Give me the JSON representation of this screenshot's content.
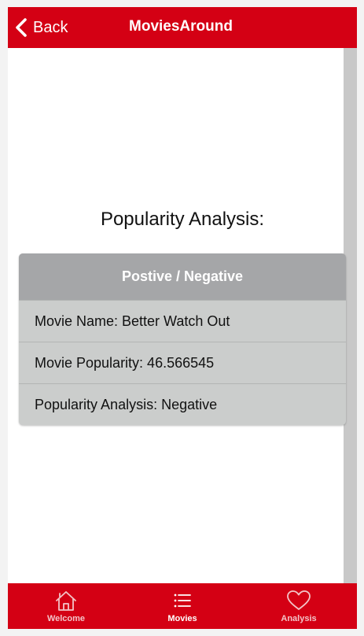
{
  "header": {
    "back_label": "Back",
    "title": "MoviesAround"
  },
  "main": {
    "section_title": "Popularity Analysis:",
    "card": {
      "header": "Postive / Negative",
      "rows": [
        "Movie Name: Better Watch Out",
        "Movie Popularity: 46.566545",
        "Popularity Analysis: Negative"
      ]
    }
  },
  "tabbar": {
    "tabs": [
      {
        "label": "Welcome",
        "icon": "home-icon",
        "active": false
      },
      {
        "label": "Movies",
        "icon": "list-icon",
        "active": true
      },
      {
        "label": "Analysis",
        "icon": "heart-icon",
        "active": false
      }
    ]
  },
  "colors": {
    "brand_red": "#d40014",
    "card_header_bg": "#a5a6a8",
    "card_body_bg": "#cbcdcc"
  }
}
